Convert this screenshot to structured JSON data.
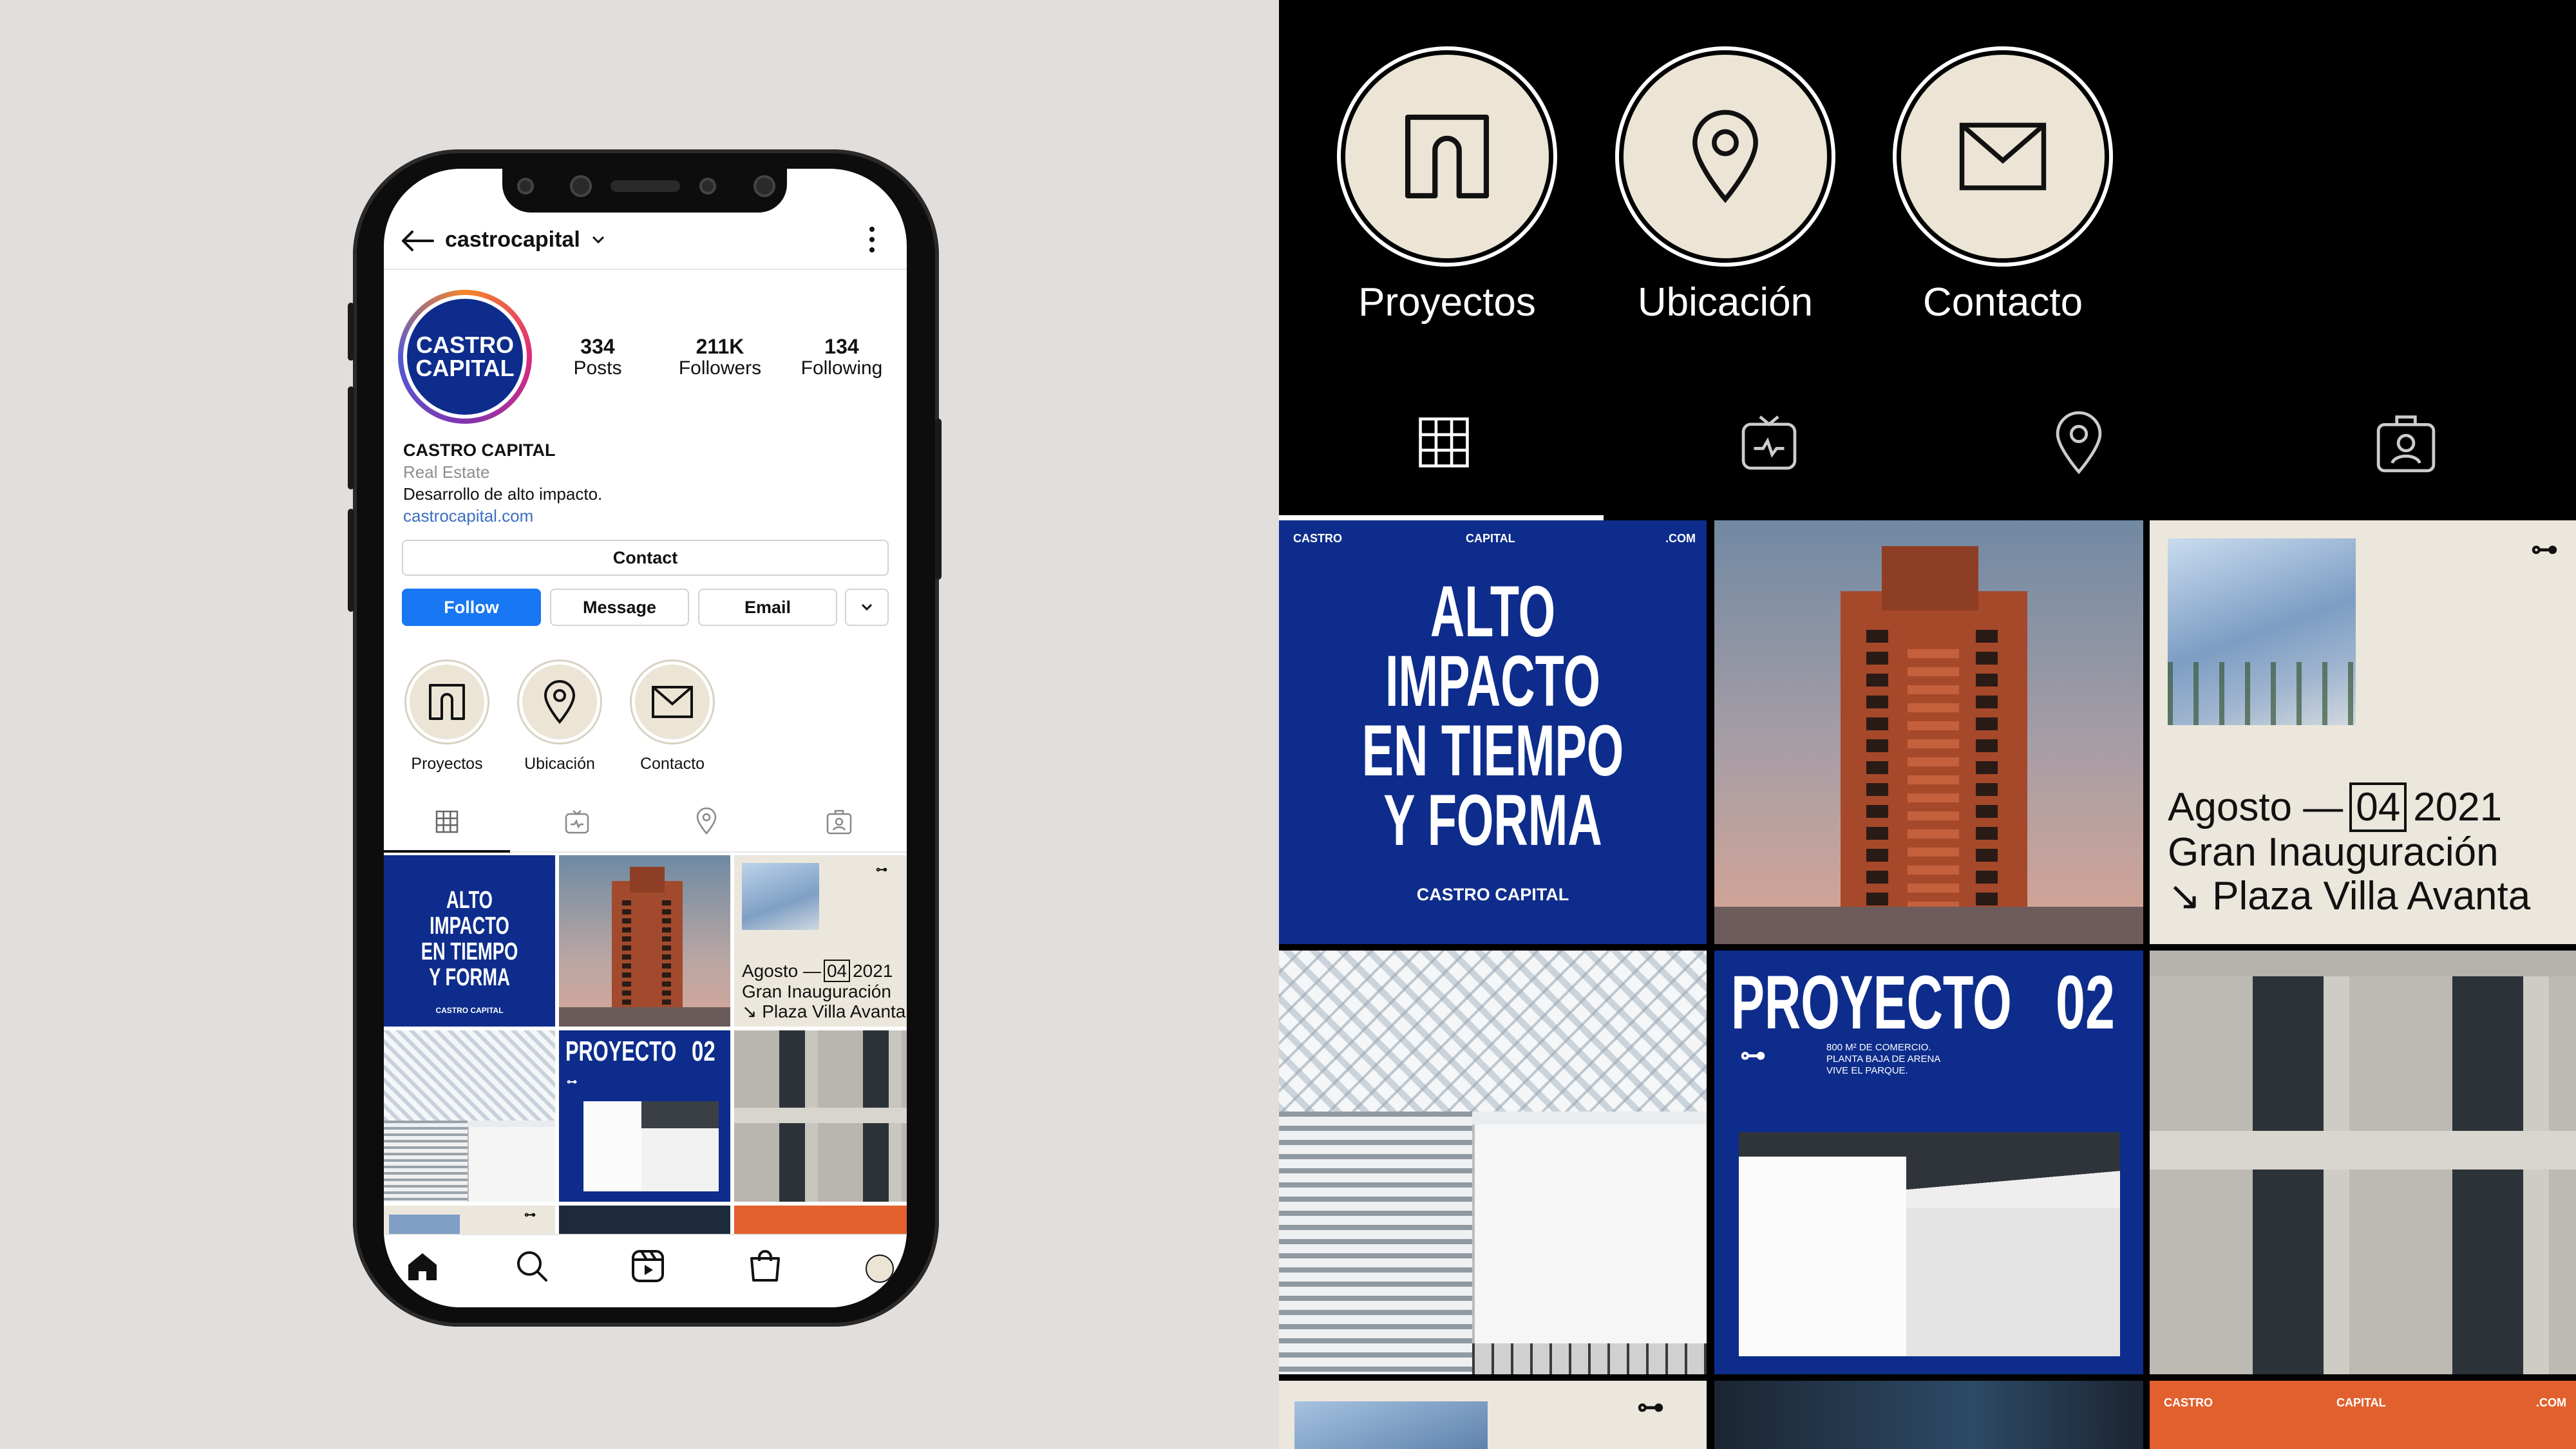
{
  "profile": {
    "username": "castrocapital",
    "avatar_text_line1": "CASTRO",
    "avatar_text_line2": "CAPITAL",
    "stats": [
      {
        "value": "334",
        "label": "Posts"
      },
      {
        "value": "211K",
        "label": "Followers"
      },
      {
        "value": "134",
        "label": "Following"
      }
    ],
    "name": "CASTRO CAPITAL",
    "category": "Real Estate",
    "bio": "Desarrollo de alto impacto.",
    "link": "castrocapital.com"
  },
  "actions": {
    "contact": "Contact",
    "follow": "Follow",
    "message": "Message",
    "email": "Email"
  },
  "highlights": [
    {
      "label": "Proyectos",
      "icon": "home-arch-icon"
    },
    {
      "label": "Ubicación",
      "icon": "location-pin-icon"
    },
    {
      "label": "Contacto",
      "icon": "envelope-icon"
    }
  ],
  "tabs": [
    "grid-icon",
    "igtv-icon",
    "tagged-location-icon",
    "tagged-person-icon"
  ],
  "posts": {
    "alto": {
      "top_left": "CASTRO",
      "top_mid": "CAPITAL",
      "top_right": ".COM",
      "headline": [
        "ALTO",
        "IMPACTO",
        "EN TIEMPO",
        "Y FORMA"
      ],
      "footer": "CASTRO CAPITAL"
    },
    "inauguracion": {
      "line1_a": "Agosto —",
      "line1_box": "04",
      "line1_b": "2021",
      "line2": "Gran Inauguración",
      "line3": "↘ Plaza Villa Avanta"
    },
    "proyecto": {
      "title": "PROYECTO",
      "number": "02",
      "copy": [
        "800 M² DE COMERCIO.",
        "PLANTA BAJA DE ARENA",
        "VIVE EL PARQUE."
      ]
    },
    "orange": {
      "left": "CASTRO",
      "mid": "CAPITAL",
      "right": ".COM"
    }
  },
  "bottom_nav": [
    "home-icon",
    "search-icon",
    "reels-icon",
    "shop-icon",
    "profile-avatar-icon"
  ],
  "colors": {
    "brand_blue": "#0d2c8c",
    "cream": "#ece5d6",
    "orange": "#e2602e",
    "ig_blue": "#1877f2"
  }
}
